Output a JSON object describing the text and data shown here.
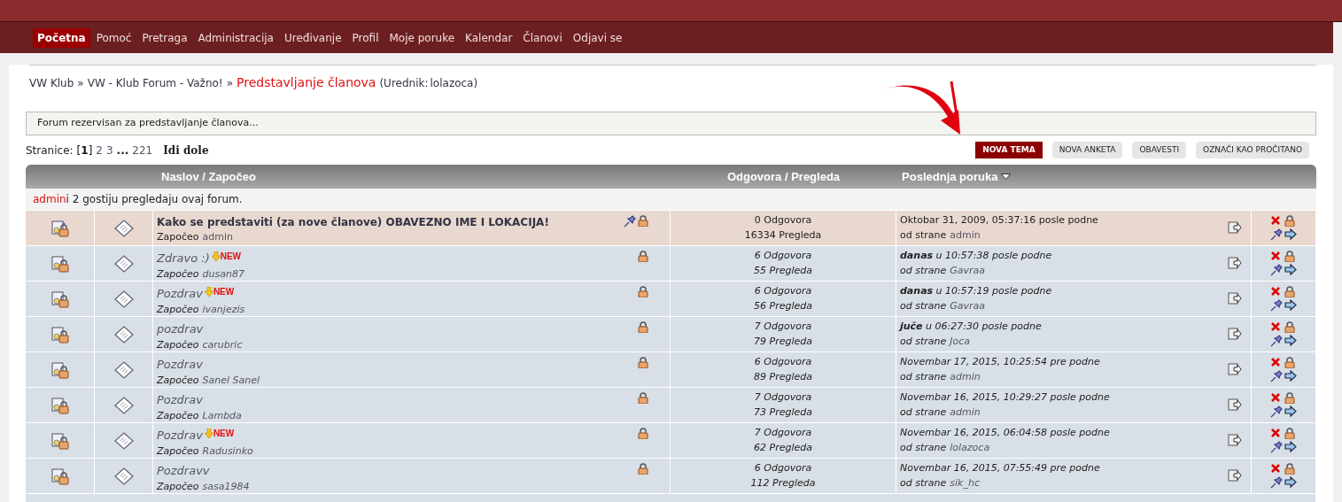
{
  "nav": [
    {
      "label": "Početna",
      "selected": true
    },
    {
      "label": "Pomoć",
      "selected": false
    },
    {
      "label": "Pretraga",
      "selected": false
    },
    {
      "label": "Administracija",
      "selected": false
    },
    {
      "label": "Uređivanje",
      "selected": false
    },
    {
      "label": "Profil",
      "selected": false
    },
    {
      "label": "Moje poruke",
      "selected": false
    },
    {
      "label": "Kalendar",
      "selected": false
    },
    {
      "label": "Članovi",
      "selected": false
    },
    {
      "label": "Odjavi se",
      "selected": false
    }
  ],
  "breadcrumb": {
    "items": [
      "VW Klub",
      "VW - Klub Forum - Važno!"
    ],
    "separator": "»",
    "current": "Predstavljanje članova",
    "moderator_prefix": "(Urednik:",
    "moderator": "lolazoca",
    "moderator_suffix": ")"
  },
  "description": "Forum rezervisan za predstavljanje članova...",
  "pagination": {
    "label": "Stranice:",
    "pages": [
      {
        "label": "[**1**]",
        "selected": true
      },
      {
        "label": "2",
        "selected": false
      },
      {
        "label": "3",
        "selected": false
      }
    ],
    "gap": "...",
    "last": "221",
    "jump": "Idi dole"
  },
  "buttons": [
    {
      "label": "NOVA TEMA",
      "highlighted": true
    },
    {
      "label": "NOVA ANKETA",
      "highlighted": false
    },
    {
      "label": "OBAVESTI",
      "highlighted": false
    },
    {
      "label": "OZNAČI KAO PROČITANO",
      "highlighted": false
    }
  ],
  "table": {
    "columns": [
      "Naslov / Započeo",
      "Odgovora / Pregleda",
      "Poslednja poruka"
    ],
    "viewers": {
      "link": "admin",
      "text": " i 2 gostiju pregledaju ovaj forum."
    },
    "rows": [
      {
        "kind": "sticky",
        "title": "Kako se predstaviti (za nove članove) OBAVEZNO IME I LOKACIJA!",
        "badge": "",
        "starter_label": "Započeo",
        "starter": "admin",
        "replies": "0 Odgovora",
        "views": "16334 Pregleda",
        "last_time": "Oktobar 31, 2009, 05:37:16 posle podne",
        "by_label": "od strane",
        "last_by": "admin"
      },
      {
        "kind": "normal",
        "title": "Zdravo :)",
        "badge": "NEW",
        "starter_label": "Započeo",
        "starter": "dusan87",
        "replies": "6 Odgovora",
        "views": "55 Pregleda",
        "last_time": "**danas** u 10:57:38 posle podne",
        "by_label": "od strane",
        "last_by": "Gavraa"
      },
      {
        "kind": "normal",
        "title": "Pozdrav",
        "badge": "NEW",
        "starter_label": "Započeo",
        "starter": "ivanjezis",
        "replies": "6 Odgovora",
        "views": "56 Pregleda",
        "last_time": "**danas** u 10:57:19 posle podne",
        "by_label": "od strane",
        "last_by": "Gavraa"
      },
      {
        "kind": "normal",
        "title": "pozdrav",
        "badge": "",
        "starter_label": "Započeo",
        "starter": "carubric",
        "replies": "7 Odgovora",
        "views": "79 Pregleda",
        "last_time": "**juče** u 06:27:30 posle podne",
        "by_label": "od strane",
        "last_by": "Joca"
      },
      {
        "kind": "normal",
        "title": "Pozdrav",
        "badge": "",
        "starter_label": "Započeo",
        "starter": "Sanel Sanel",
        "replies": "6 Odgovora",
        "views": "89 Pregleda",
        "last_time": "Novembar 17, 2015, 10:25:54 pre podne",
        "by_label": "od strane",
        "last_by": "admin"
      },
      {
        "kind": "normal",
        "title": "Pozdrav",
        "badge": "",
        "starter_label": "Započeo",
        "starter": "Lambda",
        "replies": "7 Odgovora",
        "views": "73 Pregleda",
        "last_time": "Novembar 16, 2015, 10:29:27 posle podne",
        "by_label": "od strane",
        "last_by": "admin"
      },
      {
        "kind": "normal",
        "title": "Pozdrav",
        "badge": "NEW",
        "starter_label": "Započeo",
        "starter": "Radusinko",
        "replies": "7 Odgovora",
        "views": "62 Pregleda",
        "last_time": "Novembar 16, 2015, 06:04:58 posle podne",
        "by_label": "od strane",
        "last_by": "lolazoca"
      },
      {
        "kind": "normal",
        "title": "Pozdravv",
        "badge": "",
        "starter_label": "Započeo",
        "starter": "sasa1984",
        "replies": "6 Odgovora",
        "views": "112 Pregleda",
        "last_time": "Novembar 16, 2015, 07:55:49 pre podne",
        "by_label": "od strane",
        "last_by": "sik_hc"
      }
    ]
  }
}
